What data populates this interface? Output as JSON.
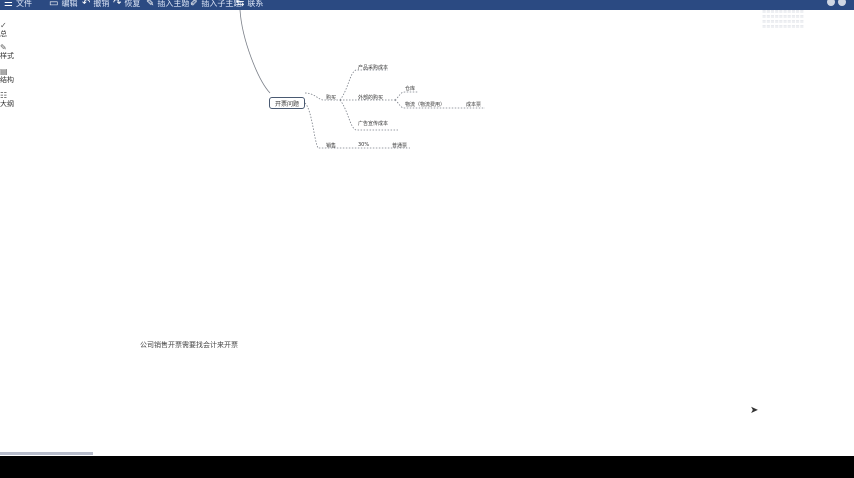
{
  "toolbar": {
    "items": [
      {
        "icon": "menu-icon",
        "glyph": "☰",
        "label": "文件"
      },
      {
        "icon": "save-icon",
        "glyph": "▭",
        "label": "编辑"
      },
      {
        "icon": "undo-icon",
        "glyph": "↶",
        "label": "撤销"
      },
      {
        "icon": "redo-icon",
        "glyph": "↷",
        "label": "恢复"
      },
      {
        "icon": "insert-topic-icon",
        "glyph": "✎",
        "label": "插入主题"
      },
      {
        "icon": "insert-subtopic-icon",
        "glyph": "✐",
        "label": "插入子主题"
      },
      {
        "icon": "relation-icon",
        "glyph": "⇆",
        "label": "联系"
      }
    ]
  },
  "sidebar": {
    "items": [
      {
        "icon": "pen-icon",
        "glyph": "✓",
        "label": "总"
      },
      {
        "icon": "brush-icon",
        "glyph": "✎",
        "label": "样式"
      },
      {
        "icon": "grid-icon",
        "glyph": "▤",
        "label": "结构"
      },
      {
        "icon": "outline-icon",
        "glyph": "☷",
        "label": "大纲"
      }
    ]
  },
  "mindmap": {
    "root": "开票问题",
    "branch_buy": "购买",
    "branch_sell": "销售",
    "buy_children": {
      "product_cost": "产品采购成本",
      "outsourced": "外部的购买",
      "ad_cost": "广告宣传成本"
    },
    "outsourced_children": {
      "warehouse": "仓库",
      "freight": "物流（物流费用）",
      "freight_note": "成本票"
    },
    "sell_children": {
      "rate": "30%",
      "note": "普通票"
    }
  },
  "caption": "公司销售开票需要找会计来开票",
  "colors": {
    "toolbar": "#2b4a82",
    "canvas": "#ffffff",
    "root_border": "#4a5a72"
  }
}
